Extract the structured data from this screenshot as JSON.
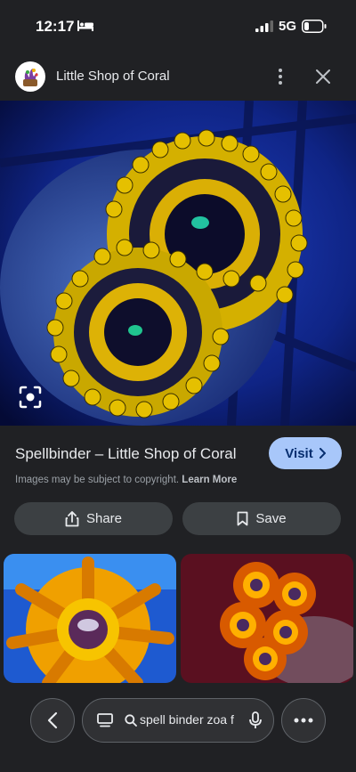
{
  "status": {
    "time": "12:17",
    "network": "5G"
  },
  "header": {
    "site_name": "Little Shop of Coral"
  },
  "result": {
    "title": "Spellbinder – Little Shop of Coral",
    "visit_label": "Visit",
    "copyright_text": "Images may be subject to copyright.",
    "learn_more": "Learn More"
  },
  "actions": {
    "share_label": "Share",
    "save_label": "Save"
  },
  "search": {
    "query": "spell binder zoa f"
  },
  "colors": {
    "accent": "#a8c7fa",
    "background": "#202124",
    "button": "#3c4043"
  }
}
